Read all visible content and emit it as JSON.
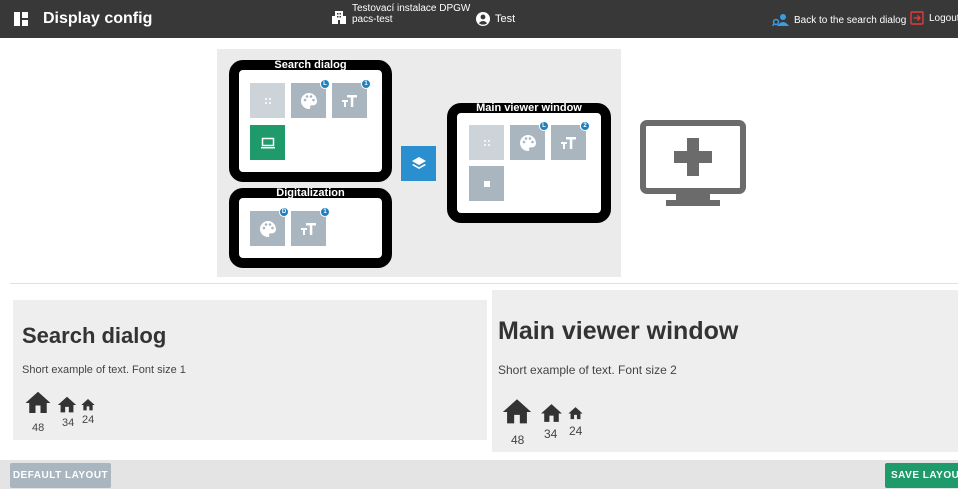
{
  "header": {
    "app_title": "Display config",
    "installation_line1": "Testovací instalace DPGW",
    "installation_line2": "pacs-test",
    "user_name": "Test",
    "back_link": "Back to the search dialog",
    "logout": "Logout"
  },
  "windows": {
    "search_dialog": {
      "title": "Search dialog",
      "tiles": [
        {
          "icon": "drag-dots-icon",
          "badge": ""
        },
        {
          "icon": "palette-icon",
          "badge": "L"
        },
        {
          "icon": "font-size-icon",
          "badge": "1"
        },
        {
          "icon": "monitor-icon",
          "badge": ""
        }
      ]
    },
    "digitalization": {
      "title": "Digitalization",
      "tiles": [
        {
          "icon": "palette-icon",
          "badge": "D"
        },
        {
          "icon": "font-size-icon",
          "badge": "1"
        }
      ]
    },
    "main_viewer": {
      "title": "Main viewer window",
      "tiles": [
        {
          "icon": "drag-dots-icon",
          "badge": ""
        },
        {
          "icon": "palette-icon",
          "badge": "L"
        },
        {
          "icon": "font-size-icon",
          "badge": "2"
        },
        {
          "icon": "square-icon",
          "badge": ""
        }
      ]
    }
  },
  "previews": {
    "search_dialog": {
      "heading": "Search dialog",
      "sample": "Short example of text. Font size 1",
      "sizes": [
        "48",
        "34",
        "24"
      ]
    },
    "main_viewer": {
      "heading": "Main viewer window",
      "sample": "Short example of text. Font size 2",
      "sizes": [
        "48",
        "34",
        "24"
      ]
    }
  },
  "footer": {
    "default_layout": "DEFAULT LAYOUT",
    "save_layout": "SAVE LAYOUT"
  },
  "colors": {
    "topbar": "#383838",
    "accent_blue": "#2a8fcf",
    "accent_green": "#1e9a6b",
    "tile_grey": "#a9b5bf"
  }
}
